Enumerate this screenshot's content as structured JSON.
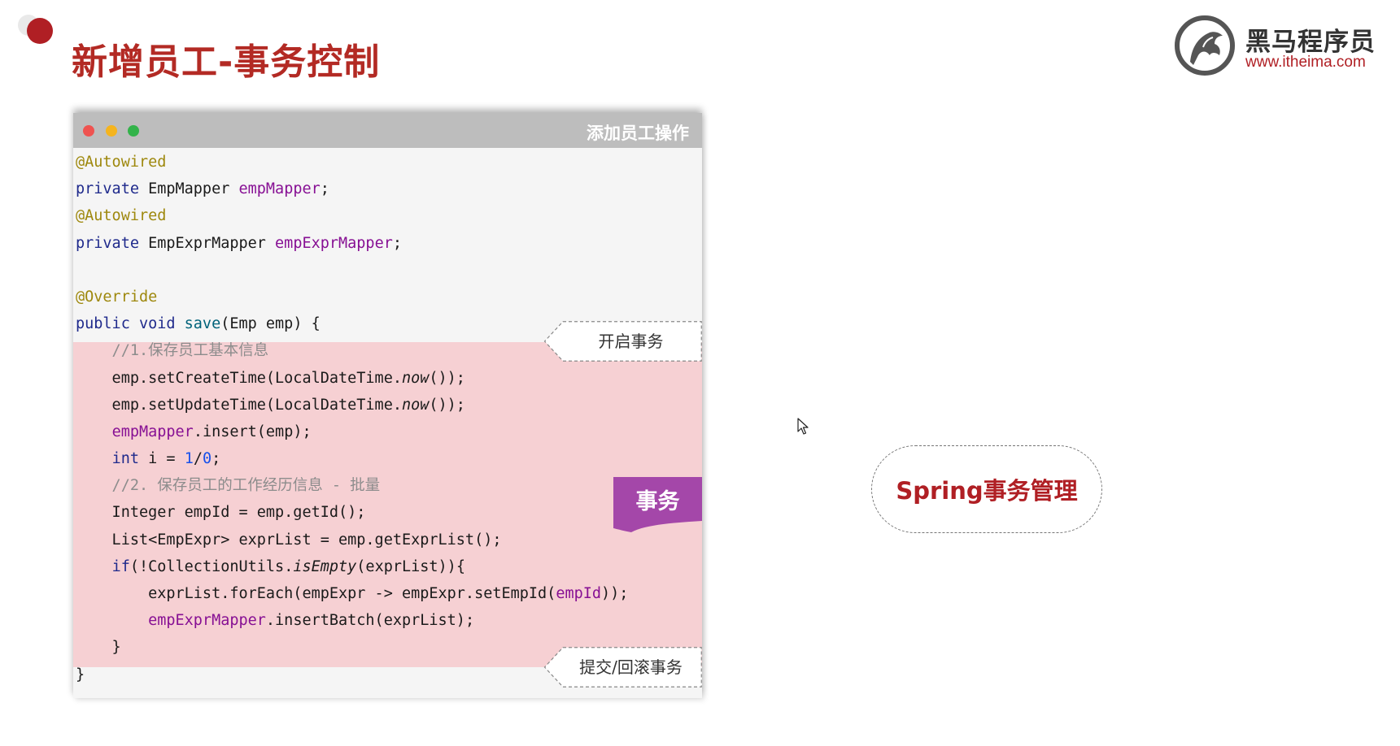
{
  "slide": {
    "title": "新增员工-事务控制"
  },
  "logo": {
    "name": "黑马程序员",
    "url": "www.itheima.com"
  },
  "window": {
    "title": "添加员工操作"
  },
  "code": {
    "l1": "@Autowired",
    "l2a": "private",
    "l2b": " EmpMapper ",
    "l2c": "empMapper",
    "l2d": ";",
    "l3": "@Autowired",
    "l4a": "private",
    "l4b": " EmpExprMapper ",
    "l4c": "empExprMapper",
    "l4d": ";",
    "l6": "@Override",
    "l7a": "public void ",
    "l7b": "save",
    "l7c": "(Emp emp) {",
    "l8": "    //1.保存员工基本信息",
    "l9a": "    emp.setCreateTime(LocalDateTime.",
    "l9b": "now",
    "l9c": "());",
    "l10a": "    emp.setUpdateTime(LocalDateTime.",
    "l10b": "now",
    "l10c": "());",
    "l11a": "    ",
    "l11b": "empMapper",
    "l11c": ".insert(emp);",
    "l12a": "    ",
    "l12b": "int",
    "l12c": " i = ",
    "l12d": "1",
    "l12e": "/",
    "l12f": "0",
    "l12g": ";",
    "l13": "    //2. 保存员工的工作经历信息 - 批量",
    "l14": "    Integer empId = emp.getId();",
    "l15": "    List<EmpExpr> exprList = emp.getExprList();",
    "l16a": "    ",
    "l16b": "if",
    "l16c": "(!CollectionUtils.",
    "l16d": "isEmpty",
    "l16e": "(exprList)){",
    "l17a": "        exprList.forEach(empExpr -> empExpr.setEmpId(",
    "l17b": "empId",
    "l17c": "));",
    "l18a": "        ",
    "l18b": "empExprMapper",
    "l18c": ".insertBatch(exprList);",
    "l19": "    }",
    "l20": "}"
  },
  "callouts": {
    "start": "开启事务",
    "end": "提交/回滚事务",
    "transaction": "事务"
  },
  "spring": {
    "label": "Spring事务管理"
  },
  "colors": {
    "title_red": "#b32a24",
    "transaction_band": "#f6d0d3",
    "transaction_tab": "#a447a9",
    "spring_text": "#b01f24"
  }
}
